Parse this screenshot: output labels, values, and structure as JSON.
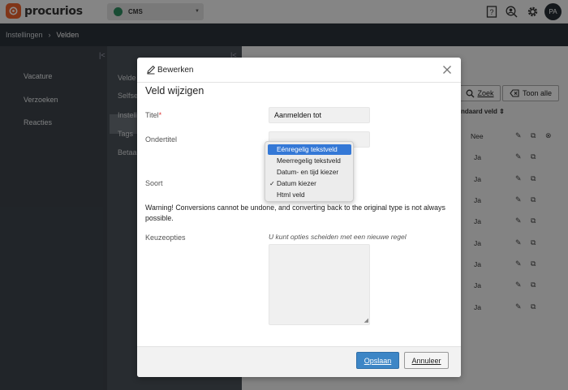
{
  "app": {
    "logo_text": "procurios",
    "org": "CMS",
    "avatar": "PA"
  },
  "icons": {
    "help": "help-book-icon",
    "search_user": "user-search-icon",
    "settings": "gear-icon"
  },
  "breadcrumb": {
    "root": "Instellingen",
    "separator": "›",
    "current": "Velden"
  },
  "sidebar": {
    "items": [
      "Vacature",
      "Verzoeken",
      "Reacties"
    ]
  },
  "subnav": {
    "items": [
      "Velde",
      "Selfse",
      "Instell",
      "Tags",
      "Betaa"
    ]
  },
  "toolbar": {
    "search_label": "Zoek",
    "show_all_label": "Toon alle"
  },
  "table": {
    "column_header": "ndaard veld ⇕",
    "rows": [
      "Nee",
      "Ja",
      "Ja",
      "Ja",
      "Ja",
      "Ja",
      "Ja",
      "Ja",
      "Ja"
    ]
  },
  "modal": {
    "header": "Bewerken",
    "title": "Veld wijzigen",
    "title_label": "Titel",
    "required_mark": "*",
    "title_value": "Aanmelden tot",
    "subtitle_label": "Ondertitel",
    "type_label": "Soort",
    "warning": "Warning! Conversions cannot be undone, and converting back to the original type is not always possible.",
    "options_label": "Keuzeopties",
    "options_hint": "U kunt opties scheiden met een nieuwe regel",
    "save_label": "Opslaan",
    "cancel_label": "Annuleer"
  },
  "dropdown": {
    "options": [
      "Eénregelig tekstveld",
      "Meerregelig tekstveld",
      "Datum- en tijd kiezer",
      "Datum kiezer",
      "Html veld"
    ],
    "highlighted_index": 0,
    "checked_index": 3,
    "check_mark": "✓"
  },
  "colors": {
    "accent": "#3d86c6",
    "highlight": "#3478d6",
    "brand": "#e9612c",
    "required": "#dd3333"
  }
}
